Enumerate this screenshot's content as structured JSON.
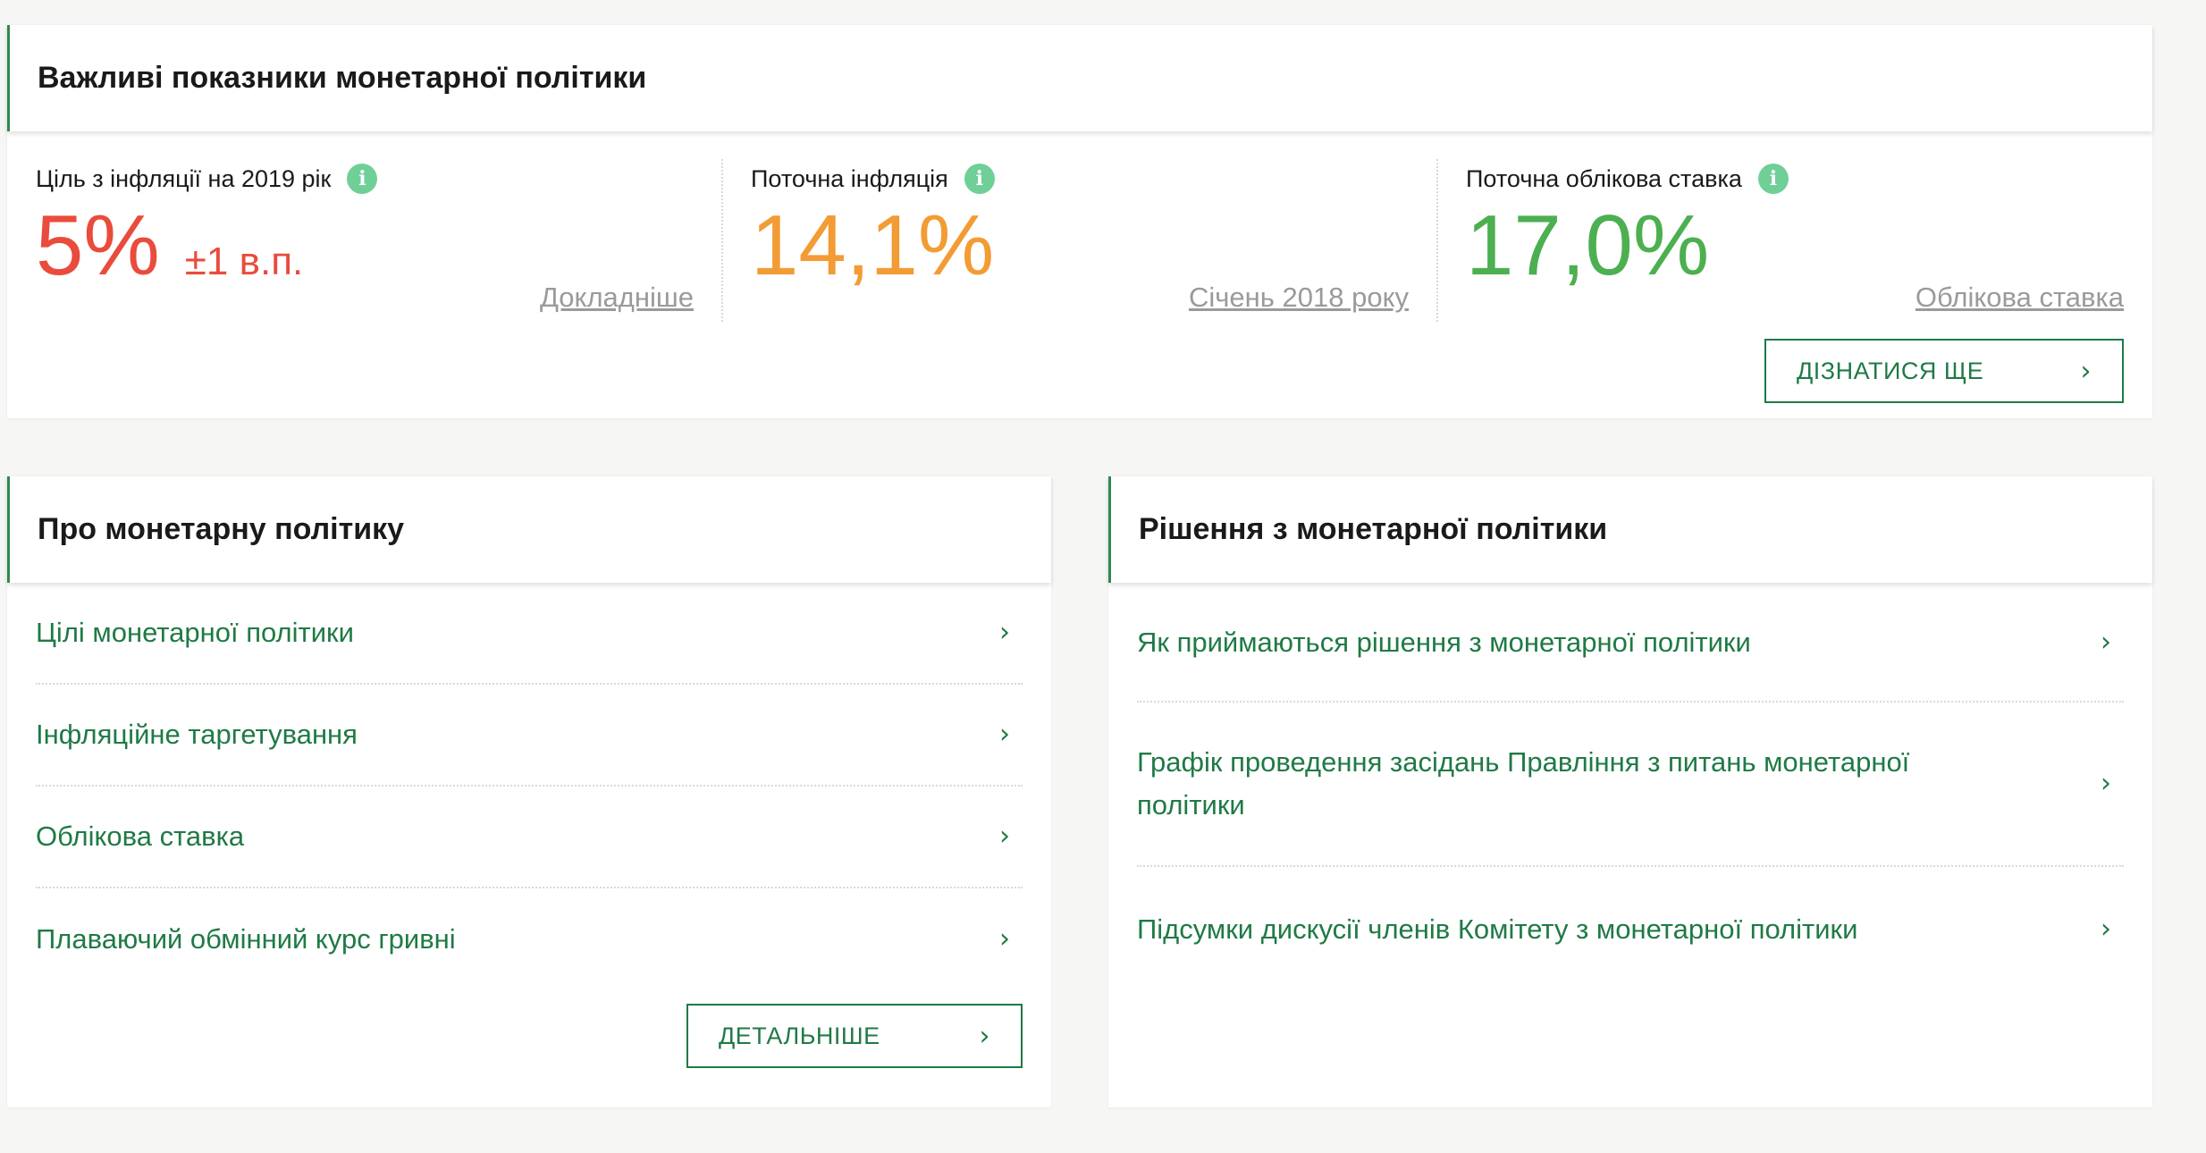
{
  "indicators_card": {
    "title": "Важливі показники монетарної політики",
    "items": [
      {
        "label": "Ціль з інфляції на 2019 рік",
        "value": "5%",
        "sub": "±1 в.п.",
        "link": "Докладніше",
        "color": "#e94b3c"
      },
      {
        "label": "Поточна інфляція",
        "value": "14,1%",
        "link": "Січень 2018 року",
        "color": "#f39b34"
      },
      {
        "label": "Поточна облікова ставка",
        "value": "17,0%",
        "link": "Облікова ставка",
        "color": "#4caf50"
      }
    ],
    "button_label": "ДІЗНАТИСЯ ЩЕ",
    "info_icon": "i"
  },
  "about_card": {
    "title": "Про монетарну політику",
    "items": [
      "Цілі монетарної політики",
      "Інфляційне таргетування",
      "Облікова ставка",
      "Плаваючий обмінний курс гривні"
    ],
    "button_label": "ДЕТАЛЬНІШЕ"
  },
  "decisions_card": {
    "title": "Рішення з монетарної політики",
    "items": [
      "Як приймаються рішення з монетарної політики",
      "Графік проведення засідань Правління з питань монетарної політики",
      "Підсумки дискусії членів Комітету з монетарної політики"
    ]
  },
  "icons": {
    "chevron": "›"
  },
  "colors": {
    "accent": "#1f7a45",
    "info": "#6fcf97"
  }
}
